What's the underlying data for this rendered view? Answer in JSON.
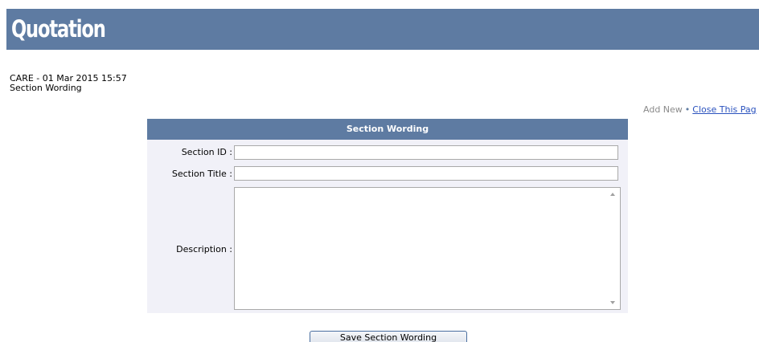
{
  "header": {
    "title": "Quotation"
  },
  "meta": {
    "line1": "CARE - 01 Mar 2015 15:57",
    "line2": "Section Wording"
  },
  "links": {
    "add_new": "Add New",
    "separator": "•",
    "close_page": "Close This Pag"
  },
  "form": {
    "title": "Section Wording",
    "section_id_label": "Section ID :",
    "section_id_value": "",
    "section_title_label": "Section Title :",
    "section_title_value": "",
    "description_label": "Description :",
    "description_value": "",
    "save_label": "Save Section Wording"
  },
  "colors": {
    "header_bg": "#5e7ba2",
    "panel_bg": "#f1f1f8",
    "link": "#2a52be"
  }
}
